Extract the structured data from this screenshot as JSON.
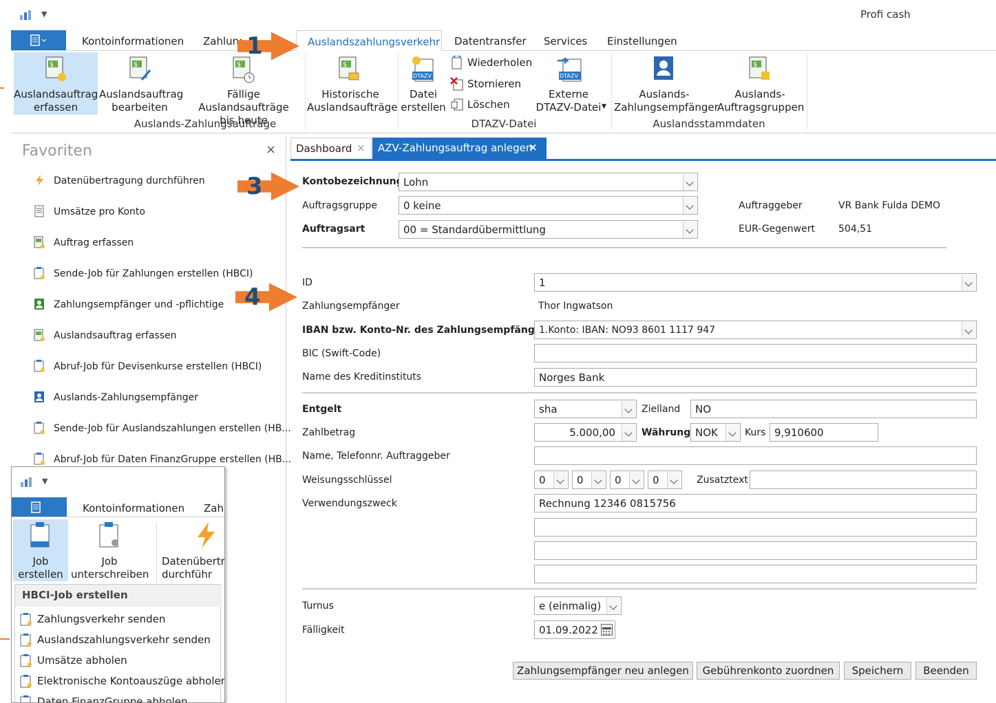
{
  "app": {
    "title": "Profi cash"
  },
  "menu": {
    "tabs": [
      "Kontoinformationen",
      "Zahlung",
      "Auslandszahlungsverkehr",
      "Datentransfer",
      "Services",
      "Einstellungen"
    ],
    "active": "Auslandszahlungsverkehr"
  },
  "ribbon": {
    "erfassen": "Auslandsauftrag\nerfassen",
    "bearbeiten": "Auslandsauftrag\nbearbeiten",
    "faellige": "Fällige Auslandsaufträge\nbis heute",
    "historische": "Historische\nAuslandsaufträge",
    "datei": "Datei\nerstellen",
    "wiederholen": "Wiederholen",
    "stornieren": "Stornieren",
    "loeschen": "Löschen",
    "externe": "Externe\nDTAZV-Datei",
    "empfaenger": "Auslands-\nZahlungsempfänger",
    "gruppen": "Auslands-\nAuftragsgruppen",
    "group1": "Auslands-Zahlungsaufträge",
    "group2": "DTAZV-Datei",
    "group3": "Auslandsstammdaten",
    "dtazv": "DTAZV"
  },
  "favorites": {
    "title": "Favoriten",
    "close": "×",
    "items": [
      "Datenübertragung durchführen",
      "Umsätze pro Konto",
      "Auftrag erfassen",
      "Sende-Job für Zahlungen erstellen (HBCI)",
      "Zahlungsempfänger und -pflichtige",
      "Auslandsauftrag erfassen",
      "Abruf-Job für Devisenkurse erstellen (HBCI)",
      "Auslands-Zahlungsempfänger",
      "Sende-Job für Auslandszahlungen erstellen (HB...",
      "Abruf-Job für Daten FinanzGruppe erstellen (HB..."
    ]
  },
  "doc_tabs": {
    "dashboard": "Dashboard",
    "close": "×",
    "active": "AZV-Zahlungsauftrag anlegen"
  },
  "form": {
    "konto_label": "Kontobezeichnung",
    "konto_value": "Lohn",
    "gruppe_label": "Auftragsgruppe",
    "gruppe_value": "0  keine",
    "art_label": "Auftragsart",
    "art_value": "00 = Standardübermittlung",
    "auftraggeber_label": "Auftraggeber",
    "auftraggeber_value": "VR Bank Fulda DEMO",
    "eur_label": "EUR-Gegenwert",
    "eur_value": "504,51",
    "id_label": "ID",
    "id_value": "1",
    "empf_label": "Zahlungsempfänger",
    "empf_value": "Thor Ingwatson",
    "iban_label": "IBAN bzw. Konto-Nr. des Zahlungsempfängers",
    "iban_value": "1.Konto: IBAN: NO93 8601 1117 947",
    "bic_label": "BIC (Swift-Code)",
    "bic_value": "",
    "bank_label": "Name des Kreditinstituts",
    "bank_value": "Norges Bank",
    "entgelt_label": "Entgelt",
    "entgelt_value": "sha",
    "zielland_label": "Zielland",
    "zielland_value": "NO",
    "betrag_label": "Zahlbetrag",
    "betrag_value": "5.000,00",
    "waehrung_label": "Währung",
    "waehrung_value": "NOK",
    "kurs_label": "Kurs",
    "kurs_value": "9,910600",
    "tel_label": "Name, Telefonnr. Auftraggeber",
    "tel_value": "",
    "weisung_label": "Weisungsschlüssel",
    "weisung_values": [
      "0",
      "0",
      "0",
      "0"
    ],
    "zusatz_label": "Zusatztext",
    "zusatz_value": "",
    "zweck_label": "Verwendungszweck",
    "zweck_values": [
      "Rechnung 12346  0815756",
      "",
      "",
      ""
    ],
    "turnus_label": "Turnus",
    "turnus_value": "e  (einmalig)",
    "faell_label": "Fälligkeit",
    "faell_value": "01.09.2022"
  },
  "buttons": {
    "neu": "Zahlungsempfänger neu anlegen",
    "gebuehr": "Gebührenkonto zuordnen",
    "speichern": "Speichern",
    "beenden": "Beenden"
  },
  "callouts": [
    "1",
    "3",
    "4"
  ],
  "inset": {
    "tabs": [
      "Kontoinformationen",
      "Zahl"
    ],
    "job_erstellen": "Job\nerstellen",
    "job_unterschreiben": "Job\nunterschreiben",
    "datenuebertragung": "Datenübertra\ndurchführ",
    "menu_header": "HBCI-Job erstellen",
    "menu_items": [
      "Zahlungsverkehr senden",
      "Auslandszahlungsverkehr senden",
      "Umsätze abholen",
      "Elektronische Kontoauszüge abholen",
      "Daten FinanzGruppe abholen"
    ]
  },
  "colors": {
    "accent": "#0078d7",
    "orange": "#ed7d31",
    "ribbon_sel": "#cce4f7"
  }
}
